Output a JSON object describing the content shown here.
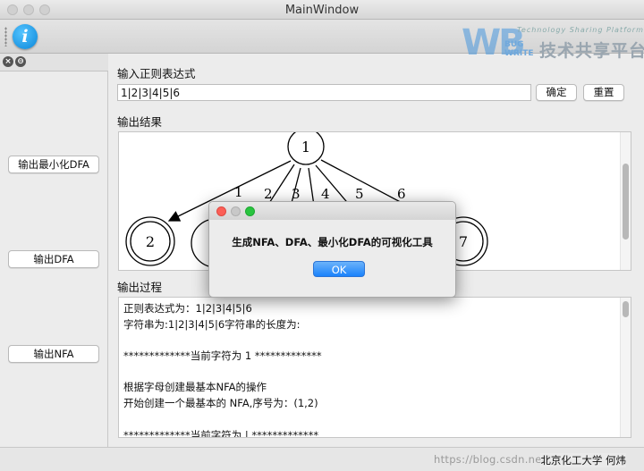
{
  "window": {
    "title": "MainWindow"
  },
  "toolbar": {
    "info_glyph": "i"
  },
  "logo": {
    "letters": "WB",
    "tagline": "Technology Sharing Platform",
    "bug": "BUG",
    "write": "WRITE",
    "chinese": "技术共享平台"
  },
  "dock": {
    "buttons": [
      "输出最小化DFA",
      "输出DFA",
      "输出NFA"
    ]
  },
  "input": {
    "label": "输入正则表达式",
    "value": "1|2|3|4|5|6",
    "confirm_label": "确定",
    "reset_label": "重置"
  },
  "graph": {
    "label": "输出结果",
    "nodes": [
      "1",
      "2",
      "7"
    ],
    "edge_labels": [
      "1",
      "2",
      "3",
      "4",
      "5",
      "6"
    ]
  },
  "process": {
    "label": "输出过程",
    "lines": [
      "正则表达式为：1|2|3|4|5|6",
      "字符串为:1|2|3|4|5|6字符串的长度为:",
      "",
      "*************当前字符为 1 *************",
      "",
      "根据字母创建最基本NFA的操作",
      "开始创建一个最基本的 NFA,序号为：(1,2)",
      "",
      "*************当前字符为 | *************"
    ]
  },
  "status": {
    "watermark": "https://blog.csdn.net/",
    "text": "北京化工大学 何炜"
  },
  "dialog": {
    "message": "生成NFA、DFA、最小化DFA的可视化工具",
    "ok_label": "OK"
  },
  "colors": {
    "ok_button": "#1a82fb",
    "close_dot": "#fc5f57",
    "minimize_dot": "#c8c8c8",
    "zoom_dot": "#29c43f"
  }
}
